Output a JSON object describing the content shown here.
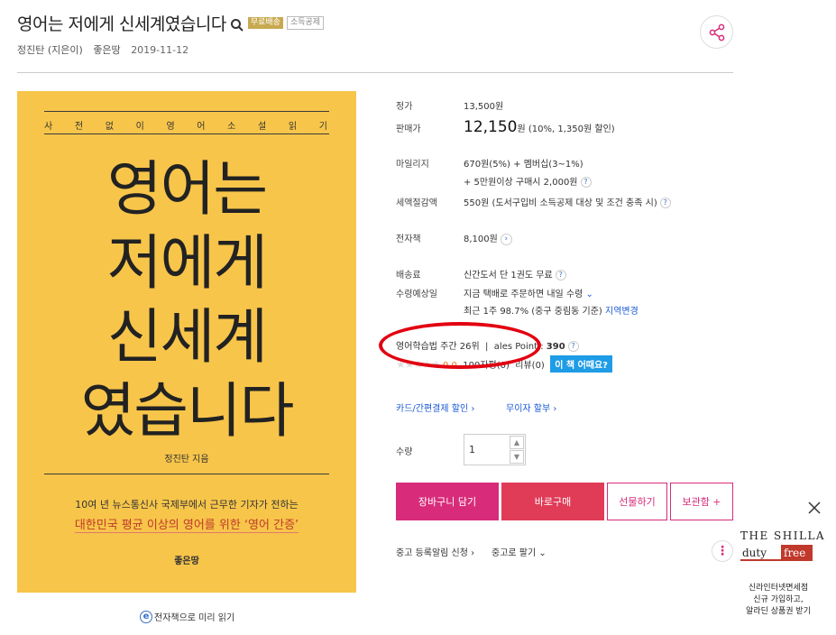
{
  "title": "영어는 저에게 신세계였습니다",
  "badges": {
    "free_shipping": "무료배송",
    "tax": "소득공제"
  },
  "meta": {
    "author": "정진탄 (지은이)",
    "publisher": "좋은땅",
    "date": "2019-11-12"
  },
  "cover": {
    "top_words": [
      "사",
      "전",
      "없",
      "이",
      "영",
      "어",
      "소",
      "설",
      "읽",
      "기"
    ],
    "title_lines": [
      "영어는",
      "저에게",
      "신세계",
      "였습니다"
    ],
    "author": "정진탄 지음",
    "subtitle1": "10여 년 뉴스통신사 국제부에서 근무한 기자가 전하는",
    "subtitle2": "대한민국 평균 이상의 영어를 위한 ‘영어 간증’",
    "publisher": "좋은땅"
  },
  "preview_label": "전자책으로 미리 읽기",
  "price": {
    "list_label": "정가",
    "list_value": "13,500원",
    "sale_label": "판매가",
    "sale_value": "12,150",
    "sale_unit": "원",
    "sale_note": "(10%, 1,350원 할인)"
  },
  "mileage": {
    "label": "마일리지",
    "line1": "670원(5%) + 멤버십(3~1%)",
    "line2": "+ 5만원이상 구매시 2,000원"
  },
  "tax_deduction": {
    "label": "세액절감액",
    "value": "550원 (도서구입비 소득공제 대상 및 조건 충족 시)"
  },
  "ebook": {
    "label": "전자책",
    "value": "8,100원"
  },
  "shipping": {
    "fee_label": "배송료",
    "fee_value": "신간도서 단 1권도 무료",
    "eta_label": "수령예상일",
    "eta_value": "지금 택배로 주문하면 내일 수령",
    "eta_note": "최근 1주 98.7% (중구 중림동 기준)",
    "region_link": "지역변경"
  },
  "rank": {
    "text": "영어학습법 주간 26위",
    "sep": "|",
    "sales_point_label": "ales Point :",
    "sales_point_value": "390"
  },
  "review": {
    "score": "0.0",
    "reviews_100": "100자평(0)",
    "reviews": "리뷰(0)",
    "cta": "이 책 어때요?"
  },
  "discounts": {
    "card": "카드/간편결제 할인",
    "interest_free": "무이자 할부"
  },
  "quantity": {
    "label": "수량",
    "value": "1"
  },
  "buttons": {
    "cart": "장바구니 담기",
    "buy": "바로구매",
    "gift": "선물하기",
    "keep": "보관함 +"
  },
  "used": {
    "notify": "중고 등록알림 신청",
    "sell": "중고로 팔기"
  },
  "ad": {
    "brand_top": "THE SHILLA",
    "brand_a": "duty",
    "brand_b": "free",
    "line1": "신라인터넷면세점",
    "line2": "신규 가입하고,",
    "line3": "알라딘 상품권 받기"
  }
}
